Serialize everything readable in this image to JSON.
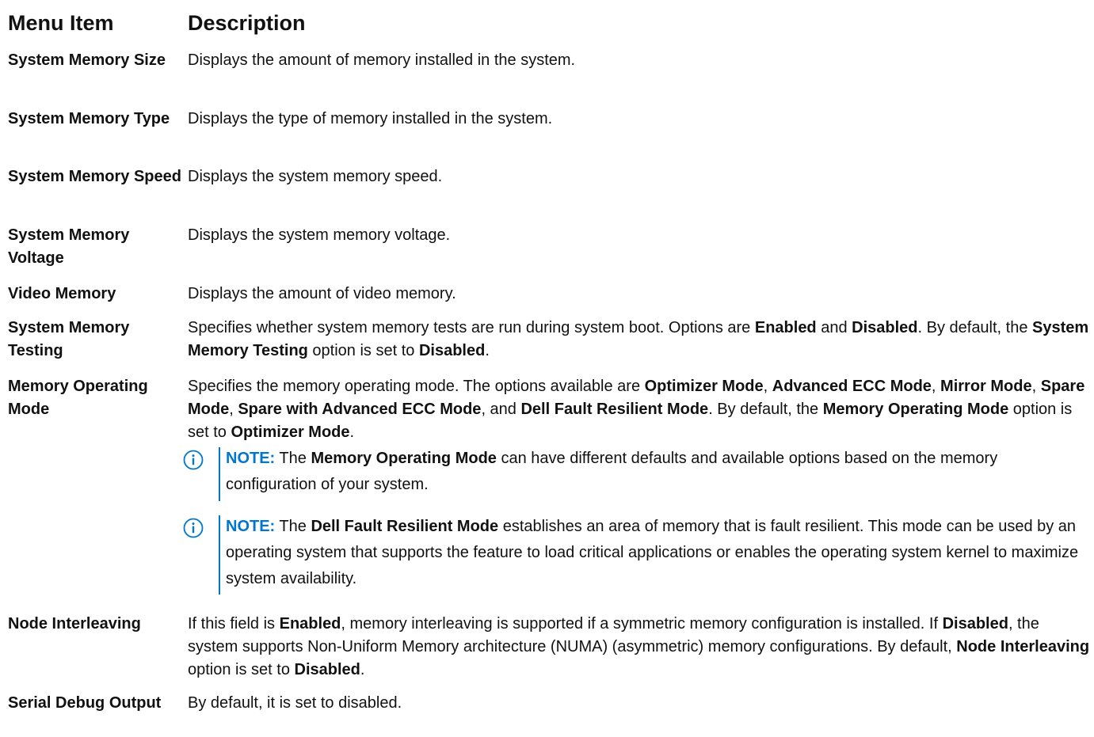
{
  "headers": {
    "menu_item": "Menu Item",
    "description": "Description"
  },
  "rows": [
    {
      "item": "System Memory Size",
      "desc": [
        "Displays the amount of memory installed in the system."
      ]
    },
    {
      "item": "System Memory Type",
      "desc": [
        "Displays the type of memory installed in the system."
      ]
    },
    {
      "item": "System Memory Speed",
      "desc": [
        "Displays the system memory speed."
      ]
    },
    {
      "item": "System Memory Voltage",
      "desc": [
        "Displays the system memory voltage."
      ]
    },
    {
      "item": "Video Memory",
      "desc": [
        "Displays the amount of video memory."
      ]
    },
    {
      "item": "System Memory Testing",
      "desc": [
        "Specifies whether system memory tests are run during system boot. Options are ",
        "Enabled",
        " and ",
        "Disabled",
        ". By default, the ",
        "System Memory Testing",
        " option is set to ",
        "Disabled",
        "."
      ]
    },
    {
      "item": "Memory Operating Mode",
      "desc": [
        "Specifies the memory operating mode. The options available are ",
        "Optimizer Mode",
        ", ",
        "Advanced ECC Mode",
        ", ",
        "Mirror Mode",
        ", ",
        "Spare Mode",
        ", ",
        "Spare with Advanced ECC Mode",
        ", and ",
        "Dell Fault Resilient Mode",
        ". By default, the ",
        "Memory Operating Mode",
        " option is set to ",
        "Optimizer Mode",
        "."
      ],
      "notes": [
        {
          "label": "NOTE:",
          "parts": [
            " The ",
            "Memory Operating Mode",
            " can have different defaults and available options based on the memory configuration of your system."
          ]
        },
        {
          "label": "NOTE:",
          "parts": [
            " The ",
            "Dell Fault Resilient Mode",
            " establishes an area of memory that is fault resilient. This mode can be used by an operating system that supports the feature to load critical applications or enables the operating system kernel to maximize system availability."
          ]
        }
      ]
    },
    {
      "item": "Node Interleaving",
      "desc": [
        "If this field is ",
        "Enabled",
        ", memory interleaving is supported if a symmetric memory configuration is installed. If ",
        "Disabled",
        ", the system supports Non-Uniform Memory architecture (NUMA) (asymmetric) memory configurations. By default, ",
        "Node Interleaving",
        " option is set to ",
        "Disabled",
        "."
      ]
    },
    {
      "item": "Serial Debug Output",
      "desc": [
        "By default, it is set to disabled."
      ]
    }
  ],
  "icons": {
    "note": "info-circle-icon"
  },
  "colors": {
    "note_accent": "#0076ce",
    "text": "#111111"
  }
}
